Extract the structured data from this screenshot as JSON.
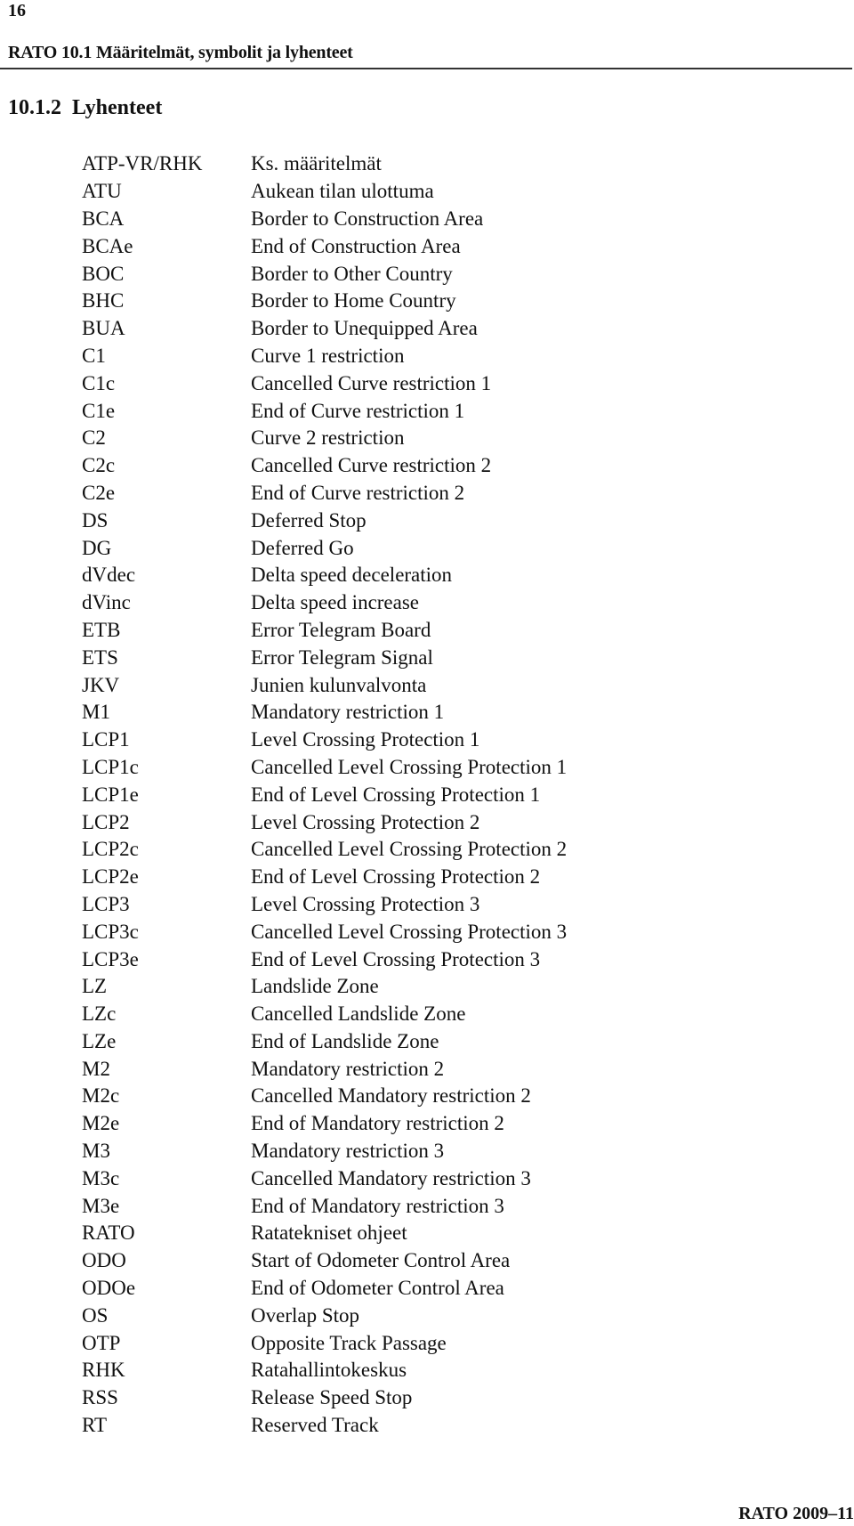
{
  "page": {
    "number": "16",
    "running_header": "RATO 10.1 Määritelmät, symbolit ja lyhenteet",
    "section": {
      "number": "10.1.2",
      "title": "Lyhenteet"
    },
    "footer": "RATO 2009–11"
  },
  "abbreviations": [
    {
      "term": "ATP-VR/RHK",
      "definition": "Ks. määritelmät"
    },
    {
      "term": "ATU",
      "definition": "Aukean tilan ulottuma"
    },
    {
      "term": "BCA",
      "definition": "Border to Construction Area"
    },
    {
      "term": "BCAe",
      "definition": "End of Construction Area"
    },
    {
      "term": "BOC",
      "definition": "Border to Other Country"
    },
    {
      "term": "BHC",
      "definition": "Border to Home Country"
    },
    {
      "term": "BUA",
      "definition": "Border to Unequipped Area"
    },
    {
      "term": "C1",
      "definition": "Curve 1 restriction"
    },
    {
      "term": "C1c",
      "definition": "Cancelled Curve restriction 1"
    },
    {
      "term": "C1e",
      "definition": "End of Curve restriction 1"
    },
    {
      "term": "C2",
      "definition": "Curve 2 restriction"
    },
    {
      "term": "C2c",
      "definition": "Cancelled Curve restriction 2"
    },
    {
      "term": "C2e",
      "definition": "End of Curve restriction 2"
    },
    {
      "term": "DS",
      "definition": "Deferred Stop"
    },
    {
      "term": "DG",
      "definition": "Deferred Go"
    },
    {
      "term": "dVdec",
      "definition": "Delta speed deceleration"
    },
    {
      "term": "dVinc",
      "definition": "Delta speed increase"
    },
    {
      "term": "ETB",
      "definition": "Error Telegram Board"
    },
    {
      "term": "ETS",
      "definition": "Error Telegram Signal"
    },
    {
      "term": "JKV",
      "definition": "Junien kulunvalvonta"
    },
    {
      "term": "M1",
      "definition": "Mandatory restriction 1"
    },
    {
      "term": "LCP1",
      "definition": "Level Crossing Protection 1"
    },
    {
      "term": "LCP1c",
      "definition": "Cancelled Level Crossing Protection 1"
    },
    {
      "term": "LCP1e",
      "definition": "End of Level Crossing Protection 1"
    },
    {
      "term": "LCP2",
      "definition": "Level Crossing Protection 2"
    },
    {
      "term": "LCP2c",
      "definition": "Cancelled Level Crossing Protection 2"
    },
    {
      "term": "LCP2e",
      "definition": "End of Level Crossing Protection 2"
    },
    {
      "term": "LCP3",
      "definition": "Level Crossing Protection 3"
    },
    {
      "term": "LCP3c",
      "definition": "Cancelled Level Crossing Protection 3"
    },
    {
      "term": "LCP3e",
      "definition": "End of Level Crossing Protection 3"
    },
    {
      "term": "LZ",
      "definition": "Landslide Zone"
    },
    {
      "term": "LZc",
      "definition": "Cancelled Landslide Zone"
    },
    {
      "term": "LZe",
      "definition": "End of Landslide Zone"
    },
    {
      "term": "M2",
      "definition": "Mandatory restriction 2"
    },
    {
      "term": "M2c",
      "definition": "Cancelled Mandatory restriction 2"
    },
    {
      "term": "M2e",
      "definition": "End of Mandatory restriction 2"
    },
    {
      "term": "M3",
      "definition": "Mandatory restriction 3"
    },
    {
      "term": "M3c",
      "definition": "Cancelled Mandatory restriction 3"
    },
    {
      "term": "M3e",
      "definition": "End of Mandatory restriction 3"
    },
    {
      "term": "RATO",
      "definition": "Ratatekniset ohjeet"
    },
    {
      "term": "ODO",
      "definition": "Start of Odometer Control Area"
    },
    {
      "term": "ODOe",
      "definition": "End of Odometer Control Area"
    },
    {
      "term": "OS",
      "definition": "Overlap Stop"
    },
    {
      "term": "OTP",
      "definition": "Opposite Track Passage"
    },
    {
      "term": "RHK",
      "definition": "Ratahallintokeskus"
    },
    {
      "term": "RSS",
      "definition": "Release Speed Stop"
    },
    {
      "term": "RT",
      "definition": "Reserved Track"
    }
  ]
}
